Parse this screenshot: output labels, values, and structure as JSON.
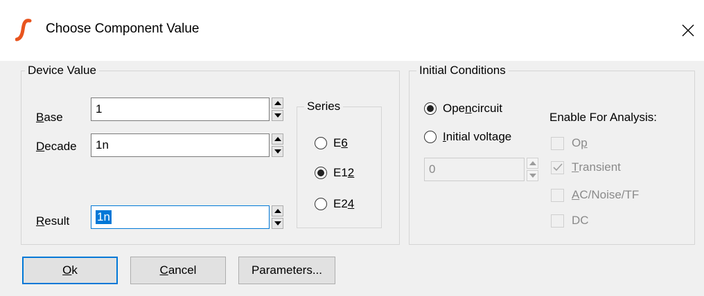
{
  "window": {
    "title": "Choose Component Value",
    "app_icon": "simetrix-logo-icon",
    "close_glyph": "✕"
  },
  "device_value": {
    "group_label": "Device Value",
    "base": {
      "label_u": "B",
      "label_rest": "ase",
      "value": "1"
    },
    "decade": {
      "label_u": "D",
      "label_rest": "ecade",
      "value": "1n"
    },
    "result": {
      "label_u": "R",
      "label_rest": "esult",
      "value": "1n"
    },
    "series": {
      "group_label": "Series",
      "options": [
        {
          "pre": "E",
          "u": "6",
          "post": "",
          "selected": false
        },
        {
          "pre": "E1",
          "u": "2",
          "post": "",
          "selected": true
        },
        {
          "pre": "E2",
          "u": "4",
          "post": "",
          "selected": false
        }
      ]
    }
  },
  "initial_conditions": {
    "group_label": "Initial Conditions",
    "open_circuit": {
      "pre": "Ope",
      "u": "n",
      "post": " circuit",
      "selected": true
    },
    "initial_voltage": {
      "pre": "",
      "u": "I",
      "post": "nitial voltage",
      "selected": false
    },
    "voltage_value": "0",
    "enable_label": "Enable For Analysis:",
    "analyses": [
      {
        "pre": "O",
        "u": "p",
        "post": "",
        "checked": false
      },
      {
        "pre": "",
        "u": "T",
        "post": "ransient",
        "checked": true
      },
      {
        "pre": "",
        "u": "A",
        "post": "C/Noise/TF",
        "checked": false
      },
      {
        "pre": "DC",
        "u": "",
        "post": "",
        "checked": false
      }
    ]
  },
  "buttons": {
    "ok": {
      "pre": "",
      "u": "O",
      "post": "k"
    },
    "cancel": {
      "pre": "",
      "u": "C",
      "post": "ancel"
    },
    "parameters": "Parameters..."
  },
  "colors": {
    "accent": "#0078d7",
    "selection": "#0078d7",
    "logo": "#e8541e"
  }
}
